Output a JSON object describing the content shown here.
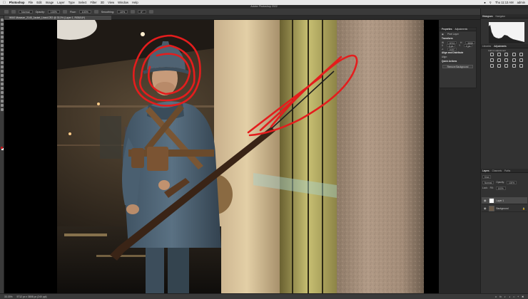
{
  "menubar": {
    "apple_icon": "apple-icon",
    "app_name": "Photoshop",
    "items": [
      "File",
      "Edit",
      "Image",
      "Layer",
      "Type",
      "Select",
      "Filter",
      "3D",
      "View",
      "Window",
      "Help"
    ],
    "clock": "Thu 11:13 AM",
    "user": "admin"
  },
  "window": {
    "title": "Adobe Photoshop 2022"
  },
  "options": {
    "mode_label": "Normal",
    "opacity_label": "Opacity:",
    "opacity_value": "100%",
    "flow_label": "Flow:",
    "flow_value": "100%",
    "smoothing_label": "Smoothing:",
    "smoothing_value": "10%",
    "angle_value": "0°"
  },
  "document": {
    "tab_title": "WW1 Museum_2145_Jacket_Lined.CR2 @ 33.3% (Layer 1, RGB/16*)"
  },
  "properties": {
    "tabs": [
      "Properties",
      "Adjustments"
    ],
    "type_label": "Pixel Layer",
    "transform_label": "Transform",
    "w_label": "W",
    "w_value": "5712 px",
    "h_label": "H",
    "h_value": "3808 px",
    "x_label": "X",
    "x_value": "0 px",
    "y_label": "Y",
    "y_value": "0 px",
    "angle_value": "0.00°",
    "align_label": "Align and Distribute",
    "align_sub": "Align:",
    "quick_label": "Quick Actions",
    "remove_bg_button": "Remove Background"
  },
  "right_panels": {
    "top_tabs": [
      "Histogram",
      "Navigator"
    ],
    "adj_tabs": [
      "Libraries",
      "Adjustments"
    ],
    "adj_add_label": "Add an adjustment",
    "layer_tabs": [
      "Layers",
      "Channels",
      "Paths"
    ],
    "kind_label": "Kind",
    "blend_mode": "Normal",
    "opacity_label": "Opacity:",
    "opacity_value": "100%",
    "lock_label": "Lock:",
    "fill_label": "Fill:",
    "fill_value": "100%",
    "layers": [
      {
        "name": "Layer 1"
      },
      {
        "name": "Background"
      }
    ]
  },
  "status": {
    "zoom": "33.33%",
    "doc_info": "5712 px x 3808 px (240 ppi)"
  },
  "colors": {
    "foreground": "#c0171b",
    "background": "#ffffff",
    "accent_red_strokes": "#e41d1d"
  }
}
